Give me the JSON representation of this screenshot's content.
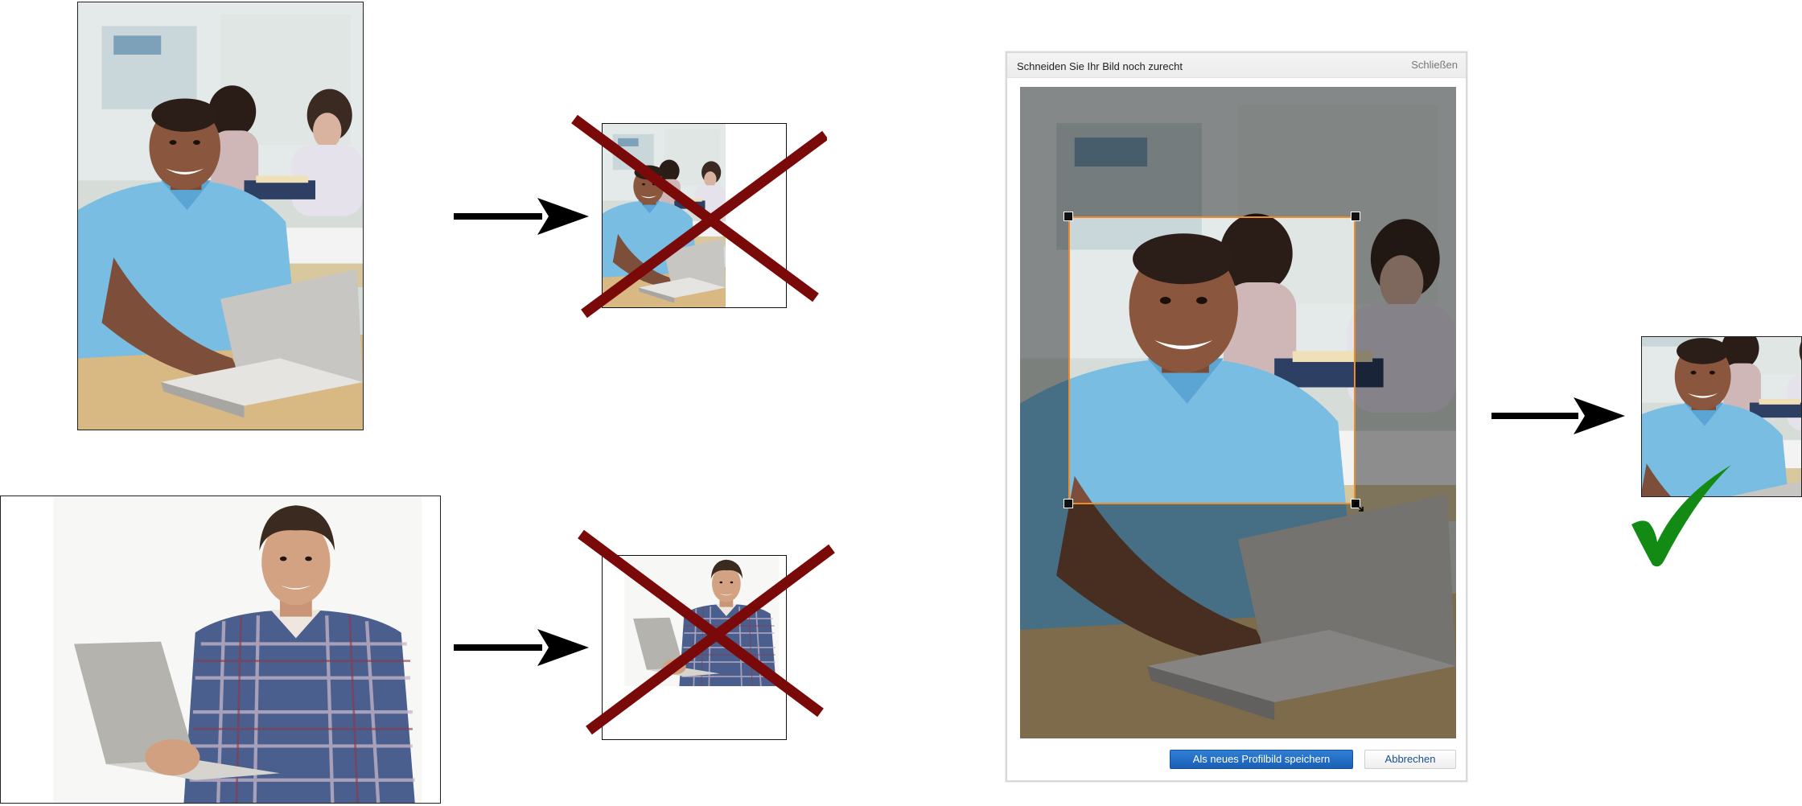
{
  "dialog": {
    "title": "Schneiden Sie Ihr Bild noch zurecht",
    "close_label": "Schließen",
    "save_label": "Als neues Profilbild speichern",
    "cancel_label": "Abbrechen"
  },
  "colors": {
    "arrow": "#000000",
    "cross": "#7a0a0a",
    "check": "#138a13",
    "crop_border": "#f08b2c",
    "primary_button": "#1a5fb4"
  },
  "icons": {
    "arrow": "right-arrow-icon",
    "cross": "cross-mark-icon",
    "check": "check-mark-icon",
    "resize": "resize-handle-icon"
  }
}
